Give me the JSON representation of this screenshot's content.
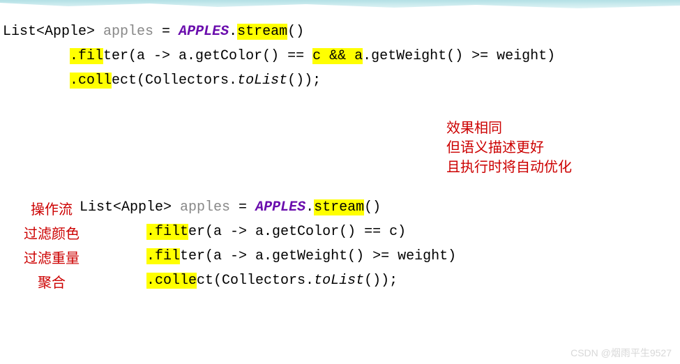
{
  "block1": {
    "line1": {
      "t1": "List<Apple> ",
      "t2": "apples",
      "t3": " = ",
      "t4": "APPLES",
      "t5": ".",
      "t6": "stream",
      "t7": "()"
    },
    "line2": {
      "pad": "        ",
      "t1": ".fil",
      "t2": "ter(a -> a.getColor() == ",
      "t3": "c && a",
      "t4": ".getWeight() >= weight)"
    },
    "line3": {
      "pad": "        ",
      "t1": ".coll",
      "t2": "ect(Collectors.",
      "t3": "toList",
      "t4": "());"
    }
  },
  "comments": {
    "l1": "效果相同",
    "l2": "但语义描述更好",
    "l3": "且执行时将自动优化"
  },
  "labels": {
    "l1": "操作流",
    "l2": "过滤颜色",
    "l3": "过滤重量",
    "l4": "聚合"
  },
  "block2": {
    "line1": {
      "t1": "List<Apple> ",
      "t2": "apples",
      "t3": " = ",
      "t4": "APPLES",
      "t5": ".",
      "t6": "stream",
      "t7": "()"
    },
    "line2": {
      "pad": "        ",
      "t1": ".filt",
      "t2": "er(a -> a.getColor() == c)"
    },
    "line3": {
      "pad": "        ",
      "t1": ".fil",
      "t2": "ter(a -> a.getWeight() >= weight)"
    },
    "line4": {
      "pad": "        ",
      "t1": ".colle",
      "t2": "ct(Collectors.",
      "t3": "toList",
      "t4": "());"
    }
  },
  "watermark": "CSDN @烟雨平生9527"
}
